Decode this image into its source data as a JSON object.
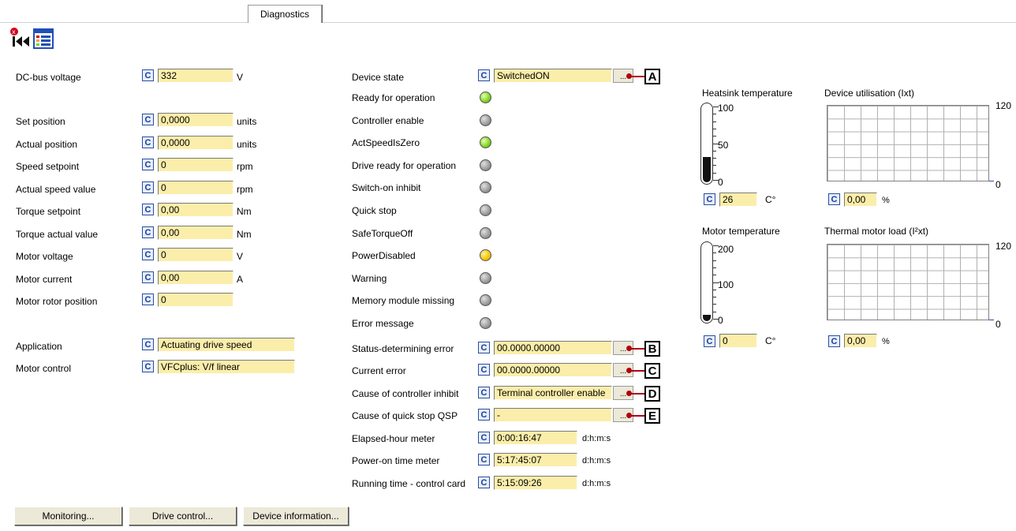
{
  "tab": {
    "label": "Diagnostics"
  },
  "left": [
    {
      "label": "DC-bus voltage",
      "value": "332",
      "unit": "V"
    },
    {
      "label": "Set position",
      "value": "0,0000",
      "unit": "units"
    },
    {
      "label": "Actual position",
      "value": "0,0000",
      "unit": "units"
    },
    {
      "label": "Speed setpoint",
      "value": "0",
      "unit": "rpm"
    },
    {
      "label": "Actual speed value",
      "value": "0",
      "unit": "rpm"
    },
    {
      "label": "Torque setpoint",
      "value": "0,00",
      "unit": "Nm"
    },
    {
      "label": "Torque actual value",
      "value": "0,00",
      "unit": "Nm"
    },
    {
      "label": "Motor voltage",
      "value": "0",
      "unit": "V"
    },
    {
      "label": "Motor current",
      "value": "0,00",
      "unit": "A"
    },
    {
      "label": "Motor rotor position",
      "value": "0",
      "unit": ""
    },
    {
      "label": "Application",
      "value": "Actuating drive speed",
      "unit": ""
    },
    {
      "label": "Motor control",
      "value": "VFCplus: V/f linear",
      "unit": ""
    }
  ],
  "c_label": "C",
  "device_state": {
    "label": "Device state",
    "value": "SwitchedON",
    "marker": "A",
    "dots": "..."
  },
  "status_leds": [
    {
      "label": "Ready for operation",
      "color": "#7ed321"
    },
    {
      "label": "Controller enable",
      "color": "#9a9a9a"
    },
    {
      "label": "ActSpeedIsZero",
      "color": "#7ed321"
    },
    {
      "label": "Drive ready for operation",
      "color": "#9a9a9a"
    },
    {
      "label": "Switch-on inhibit",
      "color": "#9a9a9a"
    },
    {
      "label": "Quick stop",
      "color": "#9a9a9a"
    },
    {
      "label": "SafeTorqueOff",
      "color": "#9a9a9a"
    },
    {
      "label": "PowerDisabled",
      "color": "#f5c400"
    },
    {
      "label": "Warning",
      "color": "#9a9a9a"
    },
    {
      "label": "Memory module missing",
      "color": "#9a9a9a"
    },
    {
      "label": "Error message",
      "color": "#9a9a9a"
    }
  ],
  "errors": [
    {
      "label": "Status-determining error",
      "value": "00.0000.00000",
      "marker": "B"
    },
    {
      "label": "Current error",
      "value": "00.0000.00000",
      "marker": "C"
    },
    {
      "label": "Cause of controller inhibit",
      "value": "Terminal controller enable",
      "marker": "D"
    },
    {
      "label": "Cause of quick stop QSP",
      "value": "-",
      "marker": "E"
    }
  ],
  "times": [
    {
      "label": "Elapsed-hour meter",
      "value": "0:00:16:47",
      "unit": "d:h:m:s"
    },
    {
      "label": "Power-on time meter",
      "value": "5:17:45:07",
      "unit": "d:h:m:s"
    },
    {
      "label": "Running time - control card",
      "value": "5:15:09:26",
      "unit": "d:h:m:s"
    }
  ],
  "heatsink": {
    "title": "Heatsink temperature",
    "max": "100",
    "mid": "50",
    "min": "0",
    "value": "26",
    "unit": "C°",
    "level": 0.26
  },
  "motor_temp": {
    "title": "Motor temperature",
    "max": "200",
    "mid": "100",
    "min": "0",
    "value": "0",
    "unit": "C°",
    "level": 0.0
  },
  "utilisation": {
    "title": "Device utilisation (Ixt)",
    "max": "120",
    "min": "0",
    "value": "0,00",
    "unit": "%"
  },
  "thermal": {
    "title": "Thermal motor load (I²xt)",
    "max": "120",
    "min": "0",
    "value": "0,00",
    "unit": "%"
  },
  "buttons": {
    "monitoring": "Monitoring...",
    "drive_control": "Drive control...",
    "device_info": "Device information..."
  }
}
